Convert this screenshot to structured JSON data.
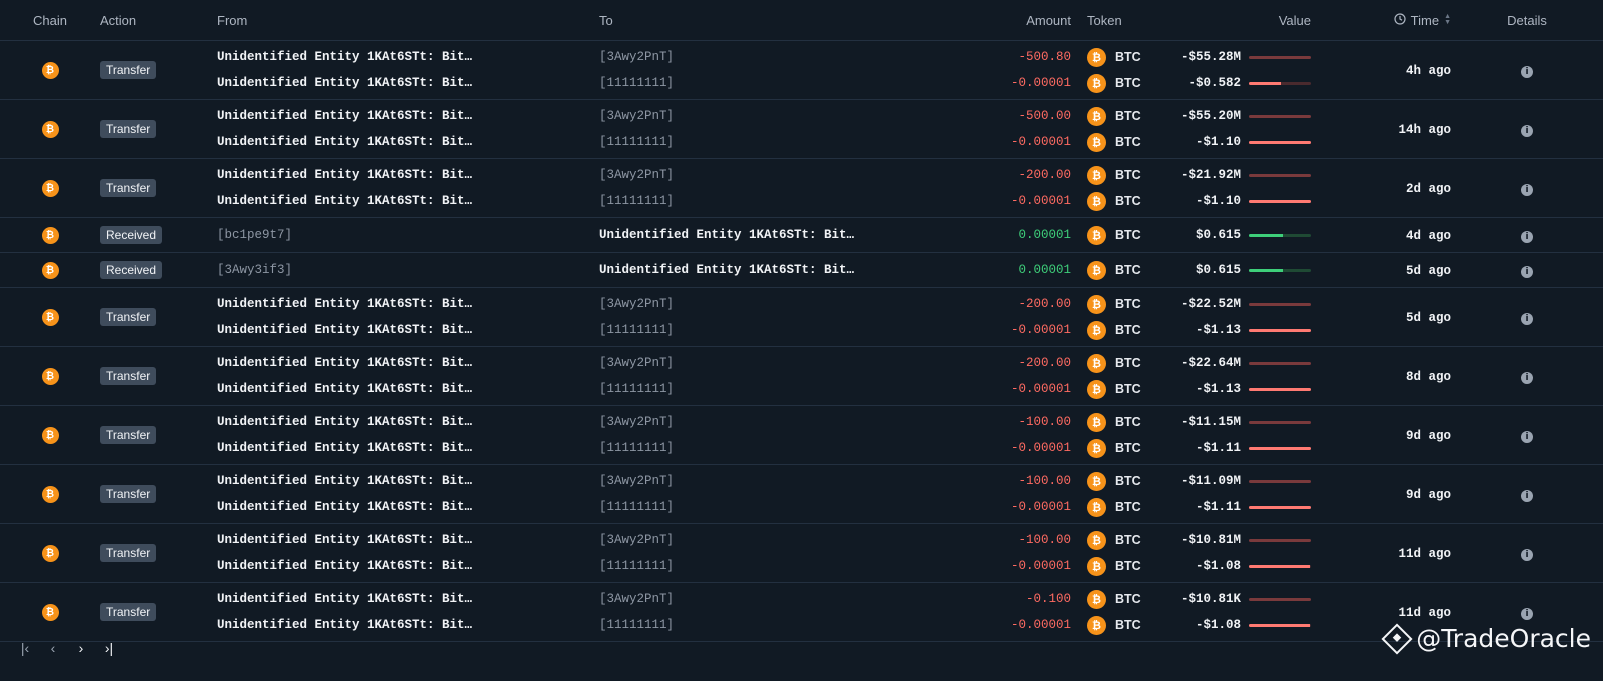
{
  "columns": {
    "chain": "Chain",
    "action": "Action",
    "from": "From",
    "to": "To",
    "amount": "Amount",
    "token": "Token",
    "value": "Value",
    "time": "Time",
    "details": "Details"
  },
  "colors": {
    "negative": "#ff6b62",
    "positive": "#3ecf7a",
    "btc": "#f7931a",
    "background": "#111a24"
  },
  "rows": [
    {
      "action": "Transfer",
      "time": "4h ago",
      "lines": [
        {
          "from": "Unidentified Entity 1KAt6STt: Bit…",
          "to": "[3Awy2PnT]",
          "amount": "-500.80",
          "token": "BTC",
          "value": "-$55.28M",
          "level": 1.0
        },
        {
          "from": "Unidentified Entity 1KAt6STt: Bit…",
          "to": "[11111111]",
          "amount": "-0.00001",
          "token": "BTC",
          "value": "-$0.582",
          "level": 0.52
        }
      ]
    },
    {
      "action": "Transfer",
      "time": "14h ago",
      "lines": [
        {
          "from": "Unidentified Entity 1KAt6STt: Bit…",
          "to": "[3Awy2PnT]",
          "amount": "-500.00",
          "token": "BTC",
          "value": "-$55.20M",
          "level": 1.0
        },
        {
          "from": "Unidentified Entity 1KAt6STt: Bit…",
          "to": "[11111111]",
          "amount": "-0.00001",
          "token": "BTC",
          "value": "-$1.10",
          "level": 1.0
        }
      ]
    },
    {
      "action": "Transfer",
      "time": "2d ago",
      "lines": [
        {
          "from": "Unidentified Entity 1KAt6STt: Bit…",
          "to": "[3Awy2PnT]",
          "amount": "-200.00",
          "token": "BTC",
          "value": "-$21.92M",
          "level": 1.0
        },
        {
          "from": "Unidentified Entity 1KAt6STt: Bit…",
          "to": "[11111111]",
          "amount": "-0.00001",
          "token": "BTC",
          "value": "-$1.10",
          "level": 1.0
        }
      ]
    },
    {
      "action": "Received",
      "time": "4d ago",
      "lines": [
        {
          "from": "[bc1pe9t7]",
          "to": "Unidentified Entity 1KAt6STt: Bit…",
          "amount": "0.00001",
          "token": "BTC",
          "value": "$0.615",
          "level": 0.55,
          "positive": true
        }
      ]
    },
    {
      "action": "Received",
      "time": "5d ago",
      "lines": [
        {
          "from": "[3Awy3if3]",
          "to": "Unidentified Entity 1KAt6STt: Bit…",
          "amount": "0.00001",
          "token": "BTC",
          "value": "$0.615",
          "level": 0.55,
          "positive": true
        }
      ]
    },
    {
      "action": "Transfer",
      "time": "5d ago",
      "lines": [
        {
          "from": "Unidentified Entity 1KAt6STt: Bit…",
          "to": "[3Awy2PnT]",
          "amount": "-200.00",
          "token": "BTC",
          "value": "-$22.52M",
          "level": 1.0
        },
        {
          "from": "Unidentified Entity 1KAt6STt: Bit…",
          "to": "[11111111]",
          "amount": "-0.00001",
          "token": "BTC",
          "value": "-$1.13",
          "level": 1.0
        }
      ]
    },
    {
      "action": "Transfer",
      "time": "8d ago",
      "lines": [
        {
          "from": "Unidentified Entity 1KAt6STt: Bit…",
          "to": "[3Awy2PnT]",
          "amount": "-200.00",
          "token": "BTC",
          "value": "-$22.64M",
          "level": 1.0
        },
        {
          "from": "Unidentified Entity 1KAt6STt: Bit…",
          "to": "[11111111]",
          "amount": "-0.00001",
          "token": "BTC",
          "value": "-$1.13",
          "level": 1.0
        }
      ]
    },
    {
      "action": "Transfer",
      "time": "9d ago",
      "lines": [
        {
          "from": "Unidentified Entity 1KAt6STt: Bit…",
          "to": "[3Awy2PnT]",
          "amount": "-100.00",
          "token": "BTC",
          "value": "-$11.15M",
          "level": 1.0
        },
        {
          "from": "Unidentified Entity 1KAt6STt: Bit…",
          "to": "[11111111]",
          "amount": "-0.00001",
          "token": "BTC",
          "value": "-$1.11",
          "level": 1.0
        }
      ]
    },
    {
      "action": "Transfer",
      "time": "9d ago",
      "lines": [
        {
          "from": "Unidentified Entity 1KAt6STt: Bit…",
          "to": "[3Awy2PnT]",
          "amount": "-100.00",
          "token": "BTC",
          "value": "-$11.09M",
          "level": 1.0
        },
        {
          "from": "Unidentified Entity 1KAt6STt: Bit…",
          "to": "[11111111]",
          "amount": "-0.00001",
          "token": "BTC",
          "value": "-$1.11",
          "level": 1.0
        }
      ]
    },
    {
      "action": "Transfer",
      "time": "11d ago",
      "lines": [
        {
          "from": "Unidentified Entity 1KAt6STt: Bit…",
          "to": "[3Awy2PnT]",
          "amount": "-100.00",
          "token": "BTC",
          "value": "-$10.81M",
          "level": 1.0
        },
        {
          "from": "Unidentified Entity 1KAt6STt: Bit…",
          "to": "[11111111]",
          "amount": "-0.00001",
          "token": "BTC",
          "value": "-$1.08",
          "level": 0.98
        }
      ]
    },
    {
      "action": "Transfer",
      "time": "11d ago",
      "lines": [
        {
          "from": "Unidentified Entity 1KAt6STt: Bit…",
          "to": "[3Awy2PnT]",
          "amount": "-0.100",
          "token": "BTC",
          "value": "-$10.81K",
          "level": 1.0
        },
        {
          "from": "Unidentified Entity 1KAt6STt: Bit…",
          "to": "[11111111]",
          "amount": "-0.00001",
          "token": "BTC",
          "value": "-$1.08",
          "level": 0.98
        }
      ]
    }
  ],
  "pagination": {
    "first": "first-page-icon",
    "prev": "prev-page-icon",
    "next": "next-page-icon",
    "last": "last-page-icon"
  },
  "watermark": {
    "text": "@TradeOracle"
  }
}
